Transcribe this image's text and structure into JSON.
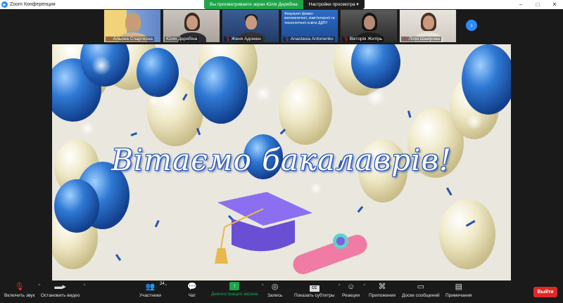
{
  "window": {
    "title": "Zoom Конференция",
    "icon": "zoom-logo-icon",
    "controls": [
      "–",
      "□",
      "✕"
    ]
  },
  "share_banner": {
    "viewing_notice": "Вы просматриваете экран Юлія Дерябіна",
    "settings_label": "Настройки просмотра ▾"
  },
  "participants": [
    {
      "name": "Альона Спартесна",
      "muted": true
    },
    {
      "name": "Юлія Дерябіна",
      "muted": false
    },
    {
      "name": "Женя Адонюн",
      "muted": true
    },
    {
      "name": "Anastasia Antonenko",
      "muted": true,
      "slide_text": "Факультет фізико-математичної, комп'ютерної та технологічної освіти ДДПУ"
    },
    {
      "name": "Вікторія Житірь",
      "muted": true
    },
    {
      "name": "Лілія Шакірова",
      "muted": true
    }
  ],
  "shared_slide": {
    "headline": "Вітаємо бакалаврів!",
    "colors": {
      "balloon_blue": "#2f79d4",
      "balloon_cream": "#efe8c6",
      "cap": "#7b5fe0",
      "diploma": "#f07ca6"
    }
  },
  "toolbar": {
    "items": [
      {
        "label": "Включить звук",
        "icon": "mic-muted-icon"
      },
      {
        "label": "Остановить видео",
        "icon": "video-camera-icon"
      },
      {
        "label": "Участники",
        "icon": "participants-icon",
        "count": "24"
      },
      {
        "label": "Чат",
        "icon": "chat-icon"
      },
      {
        "label": "Демонстрация экрана",
        "icon": "share-screen-icon"
      },
      {
        "label": "Запись",
        "icon": "record-icon"
      },
      {
        "label": "Показать субтитры",
        "icon": "cc-icon",
        "cc": "CC"
      },
      {
        "label": "Реакции",
        "icon": "reactions-icon"
      },
      {
        "label": "Приложения",
        "icon": "apps-icon"
      },
      {
        "label": "Доски сообщений",
        "icon": "whiteboard-icon"
      },
      {
        "label": "Примечания",
        "icon": "notes-icon"
      }
    ],
    "leave_label": "Выйти"
  }
}
